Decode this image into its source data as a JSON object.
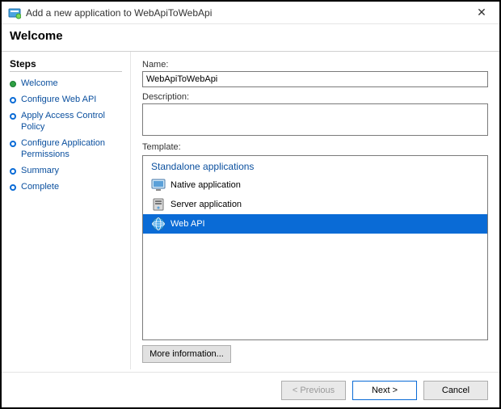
{
  "window": {
    "title": "Add a new application to WebApiToWebApi"
  },
  "welcome_heading": "Welcome",
  "sidebar": {
    "heading": "Steps",
    "items": [
      {
        "label": "Welcome",
        "current": true
      },
      {
        "label": "Configure Web API",
        "current": false
      },
      {
        "label": "Apply Access Control Policy",
        "current": false
      },
      {
        "label": "Configure Application Permissions",
        "current": false
      },
      {
        "label": "Summary",
        "current": false
      },
      {
        "label": "Complete",
        "current": false
      }
    ]
  },
  "form": {
    "name_label": "Name:",
    "name_value": "WebApiToWebApi",
    "description_label": "Description:",
    "description_value": "",
    "template_label": "Template:",
    "template_group": "Standalone applications",
    "templates": [
      {
        "label": "Native application",
        "selected": false,
        "icon": "monitor-icon"
      },
      {
        "label": "Server application",
        "selected": false,
        "icon": "server-icon"
      },
      {
        "label": "Web API",
        "selected": true,
        "icon": "globe-icon"
      }
    ],
    "more_info_label": "More information..."
  },
  "footer": {
    "previous": "< Previous",
    "next": "Next >",
    "cancel": "Cancel"
  }
}
